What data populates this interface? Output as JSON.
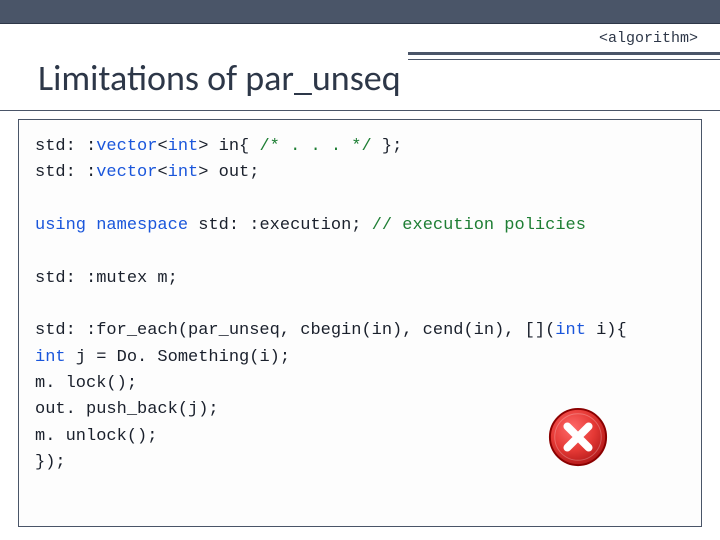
{
  "header": {
    "title": "Limitations of par_unseq",
    "tag": "<algorithm>"
  },
  "code": {
    "l1a": "std: :",
    "l1b": "vector",
    "l1c": "<",
    "l1d": "int",
    "l1e": "> in{ ",
    "l1f": "/* . . . */",
    "l1g": " };",
    "l2a": "std: :",
    "l2b": "vector",
    "l2c": "<",
    "l2d": "int",
    "l2e": "> out;",
    "l3a": "using",
    "l3b": " ",
    "l3c": "namespace",
    "l3d": " std: :execution;",
    "l3e": "   ",
    "l3f": "// execution policies",
    "l4": "std: :mutex m;",
    "l5a": "std: :for_each(par_unseq, cbegin(in), cend(in), [](",
    "l5b": "int",
    "l5c": " i){",
    "l6a": "   ",
    "l6b": "int",
    "l6c": " j = Do. Something(i);",
    "l7": "   m. lock();",
    "l8": "   out. push_back(j);",
    "l9": "   m. unlock();",
    "l10": "});"
  },
  "icons": {
    "error": "error-icon"
  }
}
